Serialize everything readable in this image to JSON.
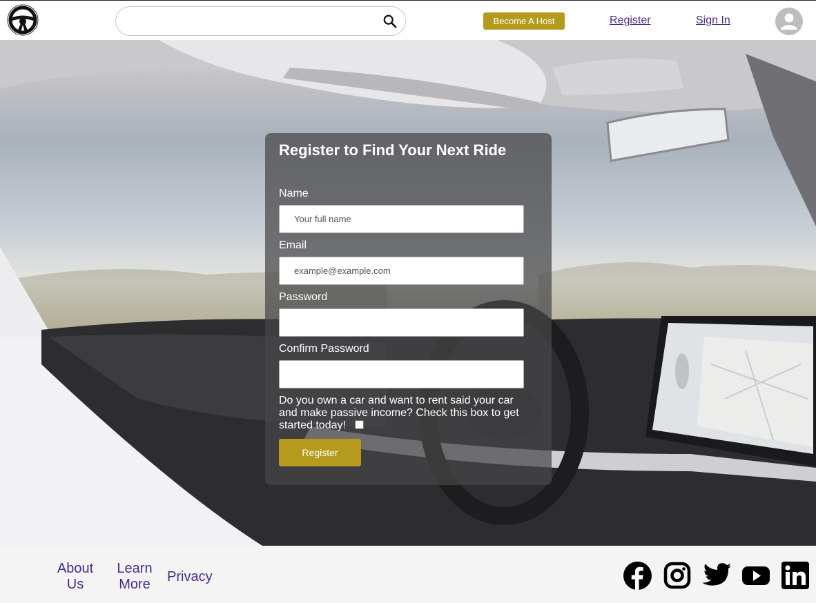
{
  "header": {
    "search": {
      "placeholder": ""
    },
    "become_host_label": "Become A Host",
    "register_label": "Register",
    "sign_in_label": "Sign In"
  },
  "form": {
    "title": "Register to Find Your Next Ride",
    "name_label": "Name",
    "name_placeholder": "Your full name",
    "email_label": "Email",
    "email_placeholder": "example@example.com",
    "password_label": "Password",
    "confirm_password_label": "Confirm Password",
    "owner_prompt": "Do you own a car and want to rent said your car and make passive income? Check this box to get started today!",
    "owner_checked": false,
    "submit_label": "Register"
  },
  "footer": {
    "about_label": "About Us",
    "learn_more_label": "Learn More",
    "privacy_label": "Privacy",
    "social_icons": [
      "facebook-icon",
      "instagram-icon",
      "twitter-icon",
      "youtube-icon",
      "linkedin-icon"
    ]
  },
  "colors": {
    "accent": "#b49b1e",
    "link": "#4b2a86",
    "footer_bg": "#f4f4f4"
  }
}
